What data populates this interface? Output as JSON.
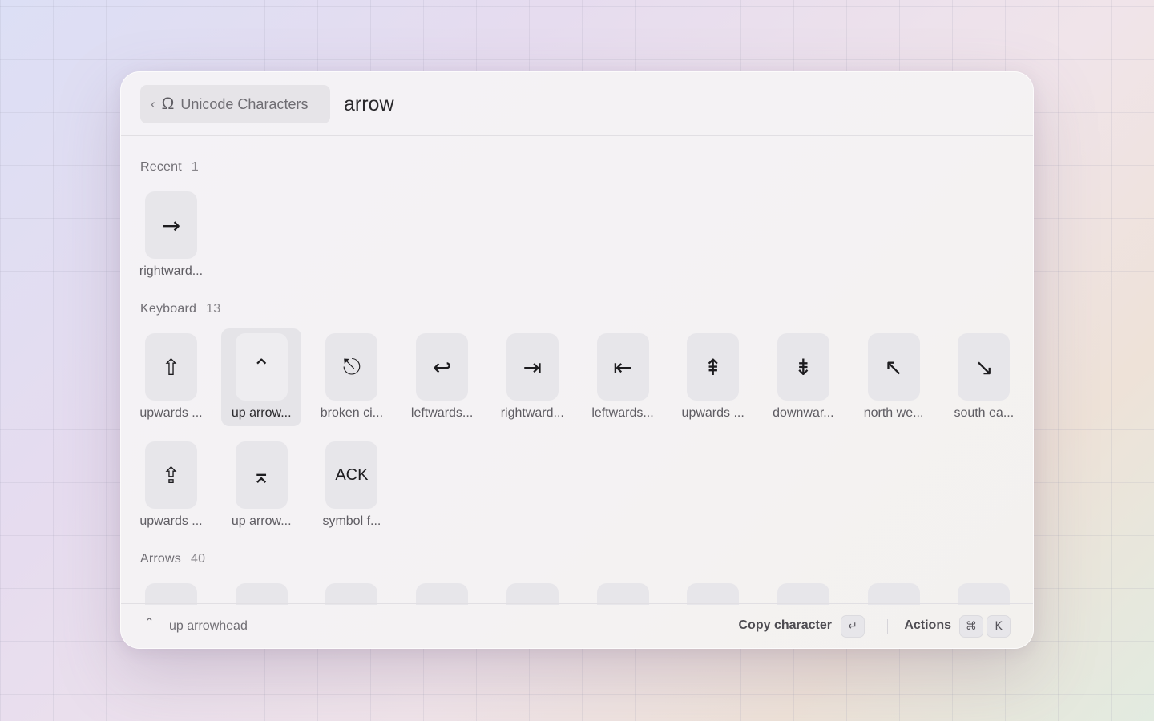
{
  "header": {
    "back_chevron": "‹",
    "extension_icon": "Ω",
    "extension_title": "Unicode Characters",
    "search_value": "arrow"
  },
  "sections": [
    {
      "title": "Recent",
      "count": "1",
      "items": [
        {
          "char": "→",
          "label": "rightward..."
        }
      ]
    },
    {
      "title": "Keyboard",
      "count": "13",
      "items": [
        {
          "char": "⇧",
          "label": "upwards ..."
        },
        {
          "char": "⌃",
          "label": "up arrow...",
          "selected": true
        },
        {
          "char": "⎋",
          "label": "broken ci..."
        },
        {
          "char": "↩",
          "label": "leftwards..."
        },
        {
          "char": "⇥",
          "label": "rightward..."
        },
        {
          "char": "⇤",
          "label": "leftwards..."
        },
        {
          "char": "⇞",
          "label": "upwards ..."
        },
        {
          "char": "⇟",
          "label": "downwar..."
        },
        {
          "char": "↖",
          "label": "north we..."
        },
        {
          "char": "↘",
          "label": "south ea..."
        },
        {
          "char": "⇪",
          "label": "upwards ..."
        },
        {
          "char": "⌅",
          "label": "up arrow..."
        },
        {
          "char": "ACK",
          "label": "symbol f..."
        }
      ]
    },
    {
      "title": "Arrows",
      "count": "40",
      "items": [
        {
          "char": ""
        },
        {
          "char": "↑"
        },
        {
          "char": "↓"
        },
        {
          "char": ""
        },
        {
          "char": ""
        },
        {
          "char": ""
        },
        {
          "char": ""
        },
        {
          "char": ""
        },
        {
          "char": ""
        },
        {
          "char": ""
        }
      ]
    }
  ],
  "footer": {
    "selected_char": "⌃",
    "selected_name": "up arrowhead",
    "primary_action": "Copy character",
    "primary_key": "↵",
    "actions_label": "Actions",
    "actions_keys": [
      "⌘",
      "K"
    ]
  },
  "colors": {
    "tile_bg": "#e7e6ea",
    "selected_bg": "#e5e4e8",
    "text_primary": "#2a292c",
    "text_muted": "#6f6d73"
  }
}
